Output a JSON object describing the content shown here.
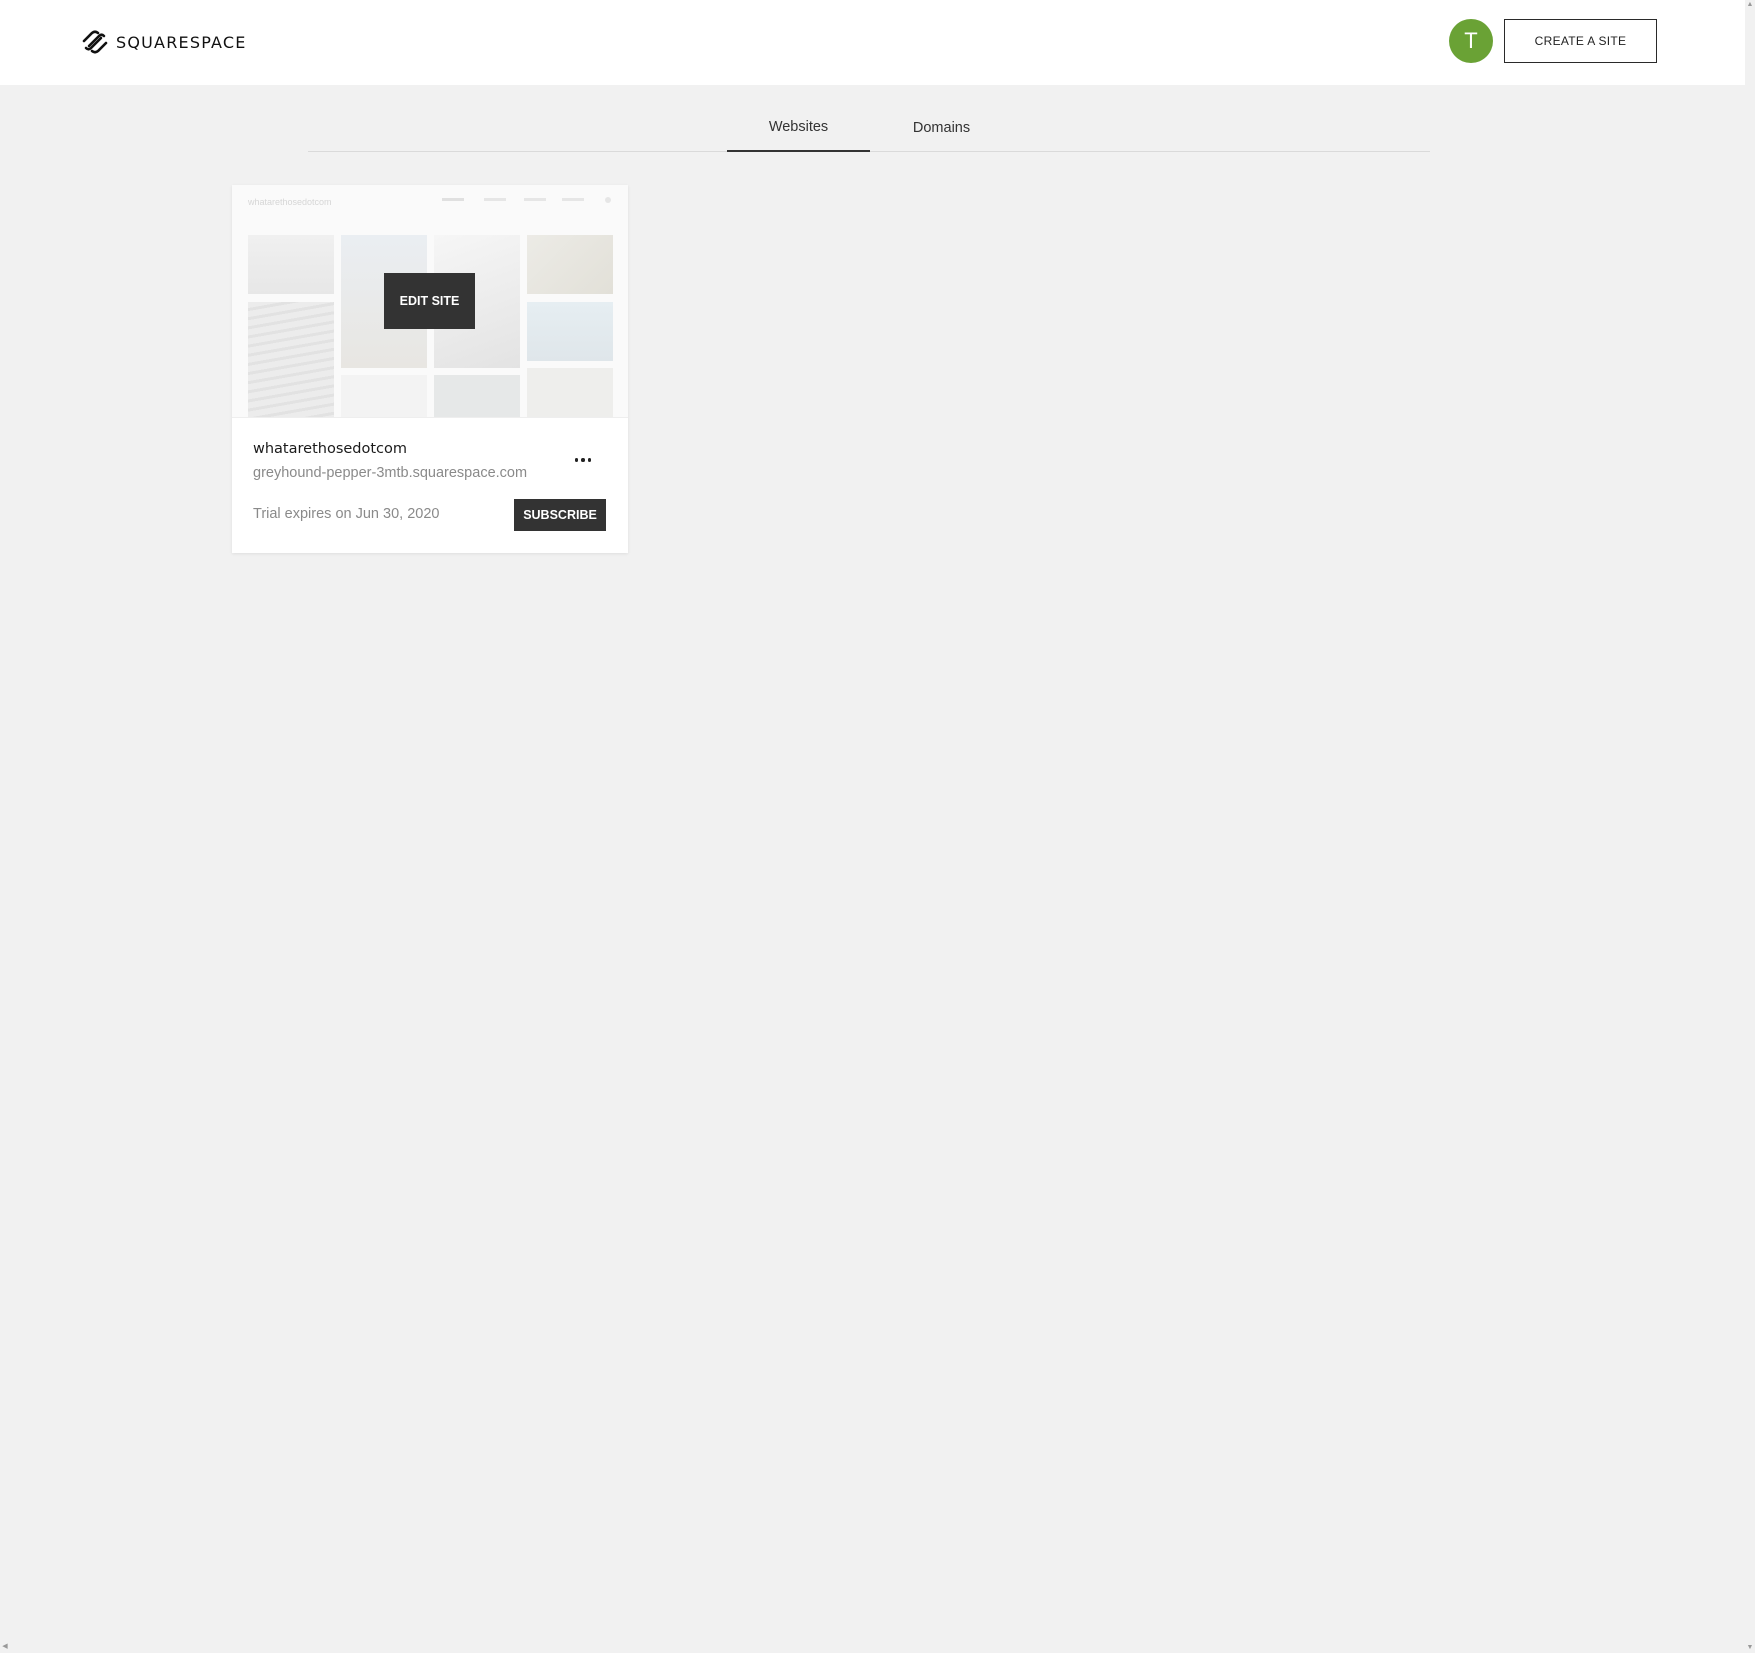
{
  "header": {
    "brand": "SQUARESPACE",
    "avatar_initial": "T",
    "create_label": "CREATE A SITE"
  },
  "tabs": [
    {
      "label": "Websites",
      "active": true
    },
    {
      "label": "Domains",
      "active": false
    }
  ],
  "sites": [
    {
      "thumb_title": "whatarethosedotcom",
      "edit_label": "EDIT SITE",
      "name": "whatarethosedotcom",
      "url": "greyhound-pepper-3mtb.squarespace.com",
      "trial": "Trial expires on Jun 30, 2020",
      "subscribe_label": "SUBSCRIBE",
      "more_icon": "more-horizontal-icon"
    }
  ],
  "colors": {
    "avatar": "#6aa235",
    "page_bg": "#f1f1f1",
    "button_dark": "#333333"
  }
}
